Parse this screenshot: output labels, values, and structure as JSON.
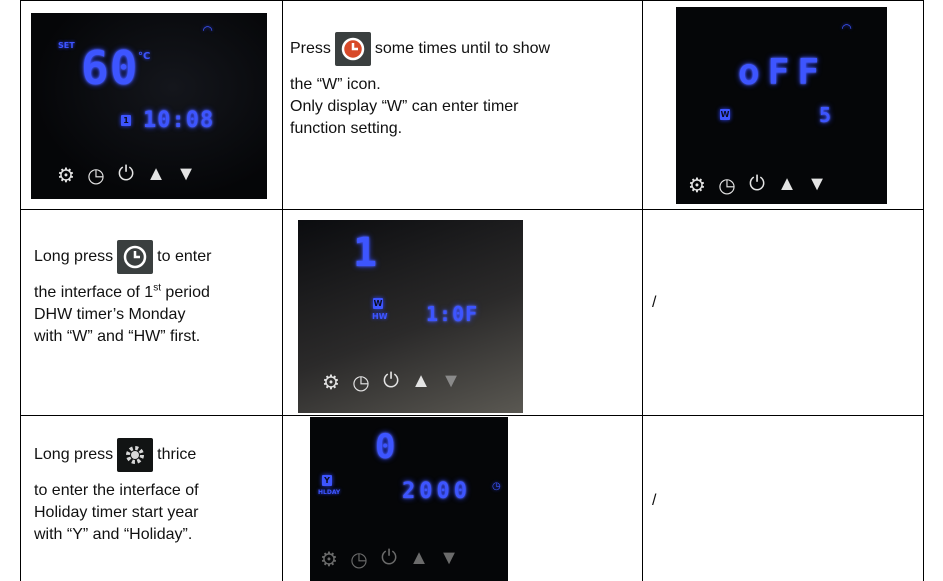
{
  "rows": [
    {
      "text_parts": {
        "before": "Press",
        "after": "some times until to show",
        "line2": "the “W” icon.",
        "line3": "Only display “W” can enter timer",
        "line4": "function setting."
      },
      "button_icon": "clock-icon",
      "left_display": {
        "set": "SET",
        "temp": "60",
        "unit": "°C",
        "time": "10:08",
        "badge": "1",
        "wifi_icon": "wifi-icon"
      },
      "right_display": {
        "value": "oFF",
        "sub": "5",
        "badge": "W",
        "wifi_icon": "wifi-icon"
      }
    },
    {
      "text_parts": {
        "before": "Long press",
        "after": "to enter",
        "line2_pre": "the interface of 1",
        "line2_sup": "st",
        "line2_post": " period",
        "line3": "DHW  timer’s Monday",
        "line4": "with “W” and “HW” first."
      },
      "button_icon": "clock-icon",
      "display": {
        "digit": "1",
        "badge": "W",
        "sub": "HW",
        "time": "1:0F"
      },
      "right_text": "/"
    },
    {
      "text_parts": {
        "before": "Long press",
        "after": "thrice",
        "line2": "to enter the interface of",
        "line3": "Holiday timer start year",
        "line4": "with “Y” and “Holiday”."
      },
      "button_icon": "gear-icon",
      "display": {
        "digit": "0",
        "badge": "Y",
        "sub": "HLDAY",
        "value": "2000"
      },
      "right_text": "/"
    }
  ],
  "panel_buttons": [
    "⚙",
    "◷",
    "⏻",
    "▲",
    "▼"
  ]
}
